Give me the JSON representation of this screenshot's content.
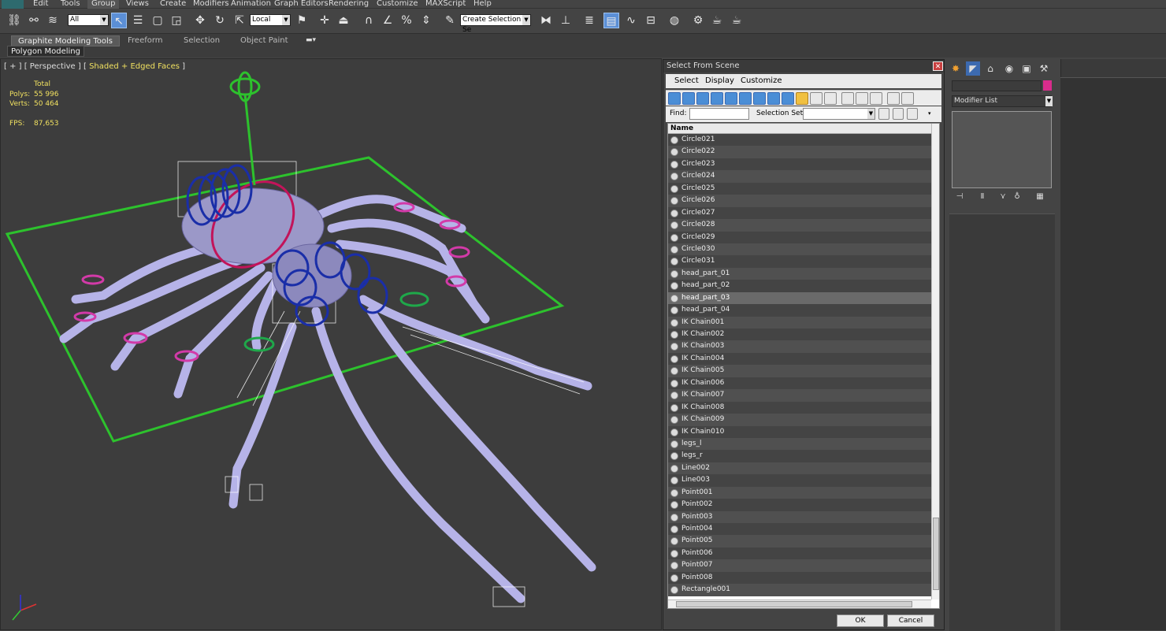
{
  "menu": [
    "Edit",
    "Tools",
    "Group",
    "Views",
    "Create",
    "Modifiers",
    "Animation",
    "Graph Editors",
    "Rendering",
    "Customize",
    "MAXScript",
    "Help"
  ],
  "toolbar": {
    "filter_value": "All",
    "coord_value": "Local",
    "selection_set_value": "Create Selection Se"
  },
  "ribbon": {
    "tabs": [
      "Graphite Modeling Tools",
      "Freeform",
      "Selection",
      "Object Paint"
    ],
    "sub_label": "Polygon Modeling"
  },
  "viewport": {
    "label_prefix": "[ + ] [ Perspective ] [ ",
    "label_mode": "Shaded + Edged Faces",
    "label_suffix": " ]",
    "stats": {
      "total_label": "Total",
      "polys_label": "Polys:",
      "polys_value": "55 996",
      "verts_label": "Verts:",
      "verts_value": "50 464",
      "fps_label": "FPS:",
      "fps_value": "87,653"
    }
  },
  "dialog": {
    "title": "Select From Scene",
    "menu": [
      "Select",
      "Display",
      "Customize"
    ],
    "find_label": "Find:",
    "selection_set_label": "Selection Set:",
    "column_name": "Name",
    "items": [
      "Circle021",
      "Circle022",
      "Circle023",
      "Circle024",
      "Circle025",
      "Circle026",
      "Circle027",
      "Circle028",
      "Circle029",
      "Circle030",
      "Circle031",
      "head_part_01",
      "head_part_02",
      "head_part_03",
      "head_part_04",
      "IK Chain001",
      "IK Chain002",
      "IK Chain003",
      "IK Chain004",
      "IK Chain005",
      "IK Chain006",
      "IK Chain007",
      "IK Chain008",
      "IK Chain009",
      "IK Chain010",
      "legs_l",
      "legs_r",
      "Line002",
      "Line003",
      "Point001",
      "Point002",
      "Point003",
      "Point004",
      "Point005",
      "Point006",
      "Point007",
      "Point008",
      "Rectangle001"
    ],
    "selected_item": "head_part_03",
    "ok_label": "OK",
    "cancel_label": "Cancel"
  },
  "command_panel": {
    "modifier_list": "Modifier List",
    "object_color": "#d92c8c"
  }
}
